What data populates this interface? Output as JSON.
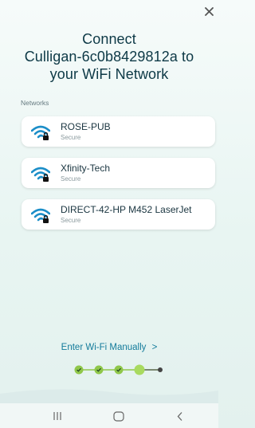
{
  "header": {
    "title_lines": [
      "Connect",
      "Culligan-6c0b8429812a to",
      "your WiFi Network"
    ]
  },
  "networks": {
    "label": "Networks",
    "items": [
      {
        "name": "ROSE-PUB",
        "status": "Secure"
      },
      {
        "name": "Xfinity-Tech",
        "status": "Secure"
      },
      {
        "name": "DIRECT-42-HP M452 LaserJet",
        "status": "Secure"
      }
    ]
  },
  "manual": {
    "label": "Enter Wi-Fi Manually",
    "chevron": ">"
  },
  "progress": {
    "total_steps": 5,
    "completed_steps": 3,
    "current_step": 4
  },
  "colors": {
    "accent_teal": "#137b9b",
    "wifi_blue": "#1c8ec8",
    "step_green": "#8fc74a",
    "step_current": "#a8da5f",
    "title": "#0d3946"
  },
  "icons": {
    "close": "close-icon",
    "wifi": "wifi-lock-icon",
    "nav_recent": "recent-apps-icon",
    "nav_home": "home-icon",
    "nav_back": "back-icon"
  }
}
